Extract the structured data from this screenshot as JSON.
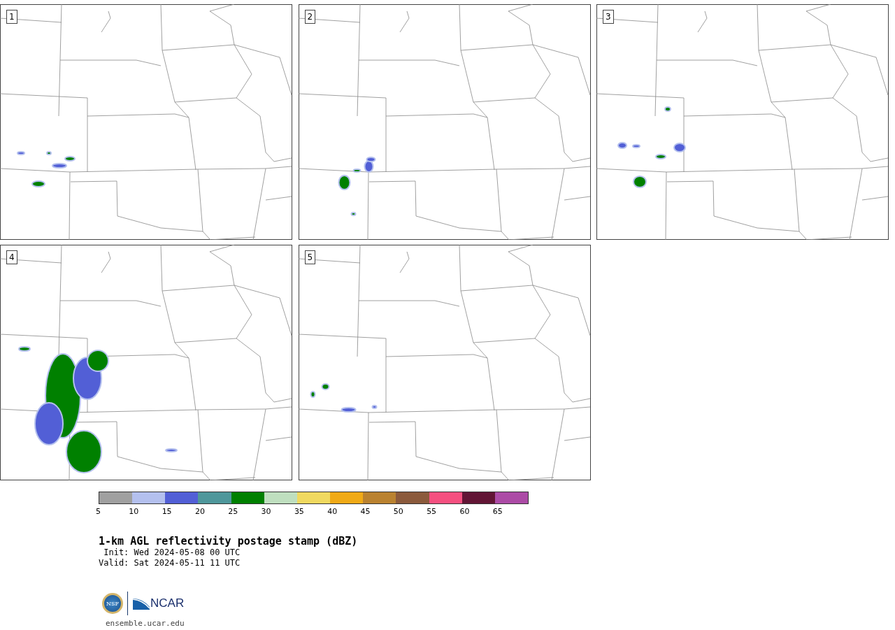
{
  "panels": [
    {
      "label": "1"
    },
    {
      "label": "2"
    },
    {
      "label": "3"
    },
    {
      "label": "4"
    },
    {
      "label": "5"
    }
  ],
  "colorbar": {
    "bins": [
      {
        "color": "#a0a0a0",
        "label": "5"
      },
      {
        "color": "#b4c0ee",
        "label": "10"
      },
      {
        "color": "#525fd6",
        "label": "15"
      },
      {
        "color": "#4f979b",
        "label": "20"
      },
      {
        "color": "#008000",
        "label": "25"
      },
      {
        "color": "#bfdfbf",
        "label": "30"
      },
      {
        "color": "#f0d960",
        "label": "35"
      },
      {
        "color": "#f0aa17",
        "label": "40"
      },
      {
        "color": "#ba8230",
        "label": "45"
      },
      {
        "color": "#8b5a3c",
        "label": "50"
      },
      {
        "color": "#f55080",
        "label": "55"
      },
      {
        "color": "#621535",
        "label": "60"
      },
      {
        "color": "#ac4ba6",
        "label": "65"
      }
    ]
  },
  "title": "1-km AGL reflectivity postage stamp (dBZ)",
  "init": " Init: Wed 2024-05-08 00 UTC",
  "valid": "Valid: Sat 2024-05-11 11 UTC",
  "logos": {
    "nsf": "NSF",
    "ncar": "NCAR"
  },
  "footer": "ensemble.ucar.edu"
}
